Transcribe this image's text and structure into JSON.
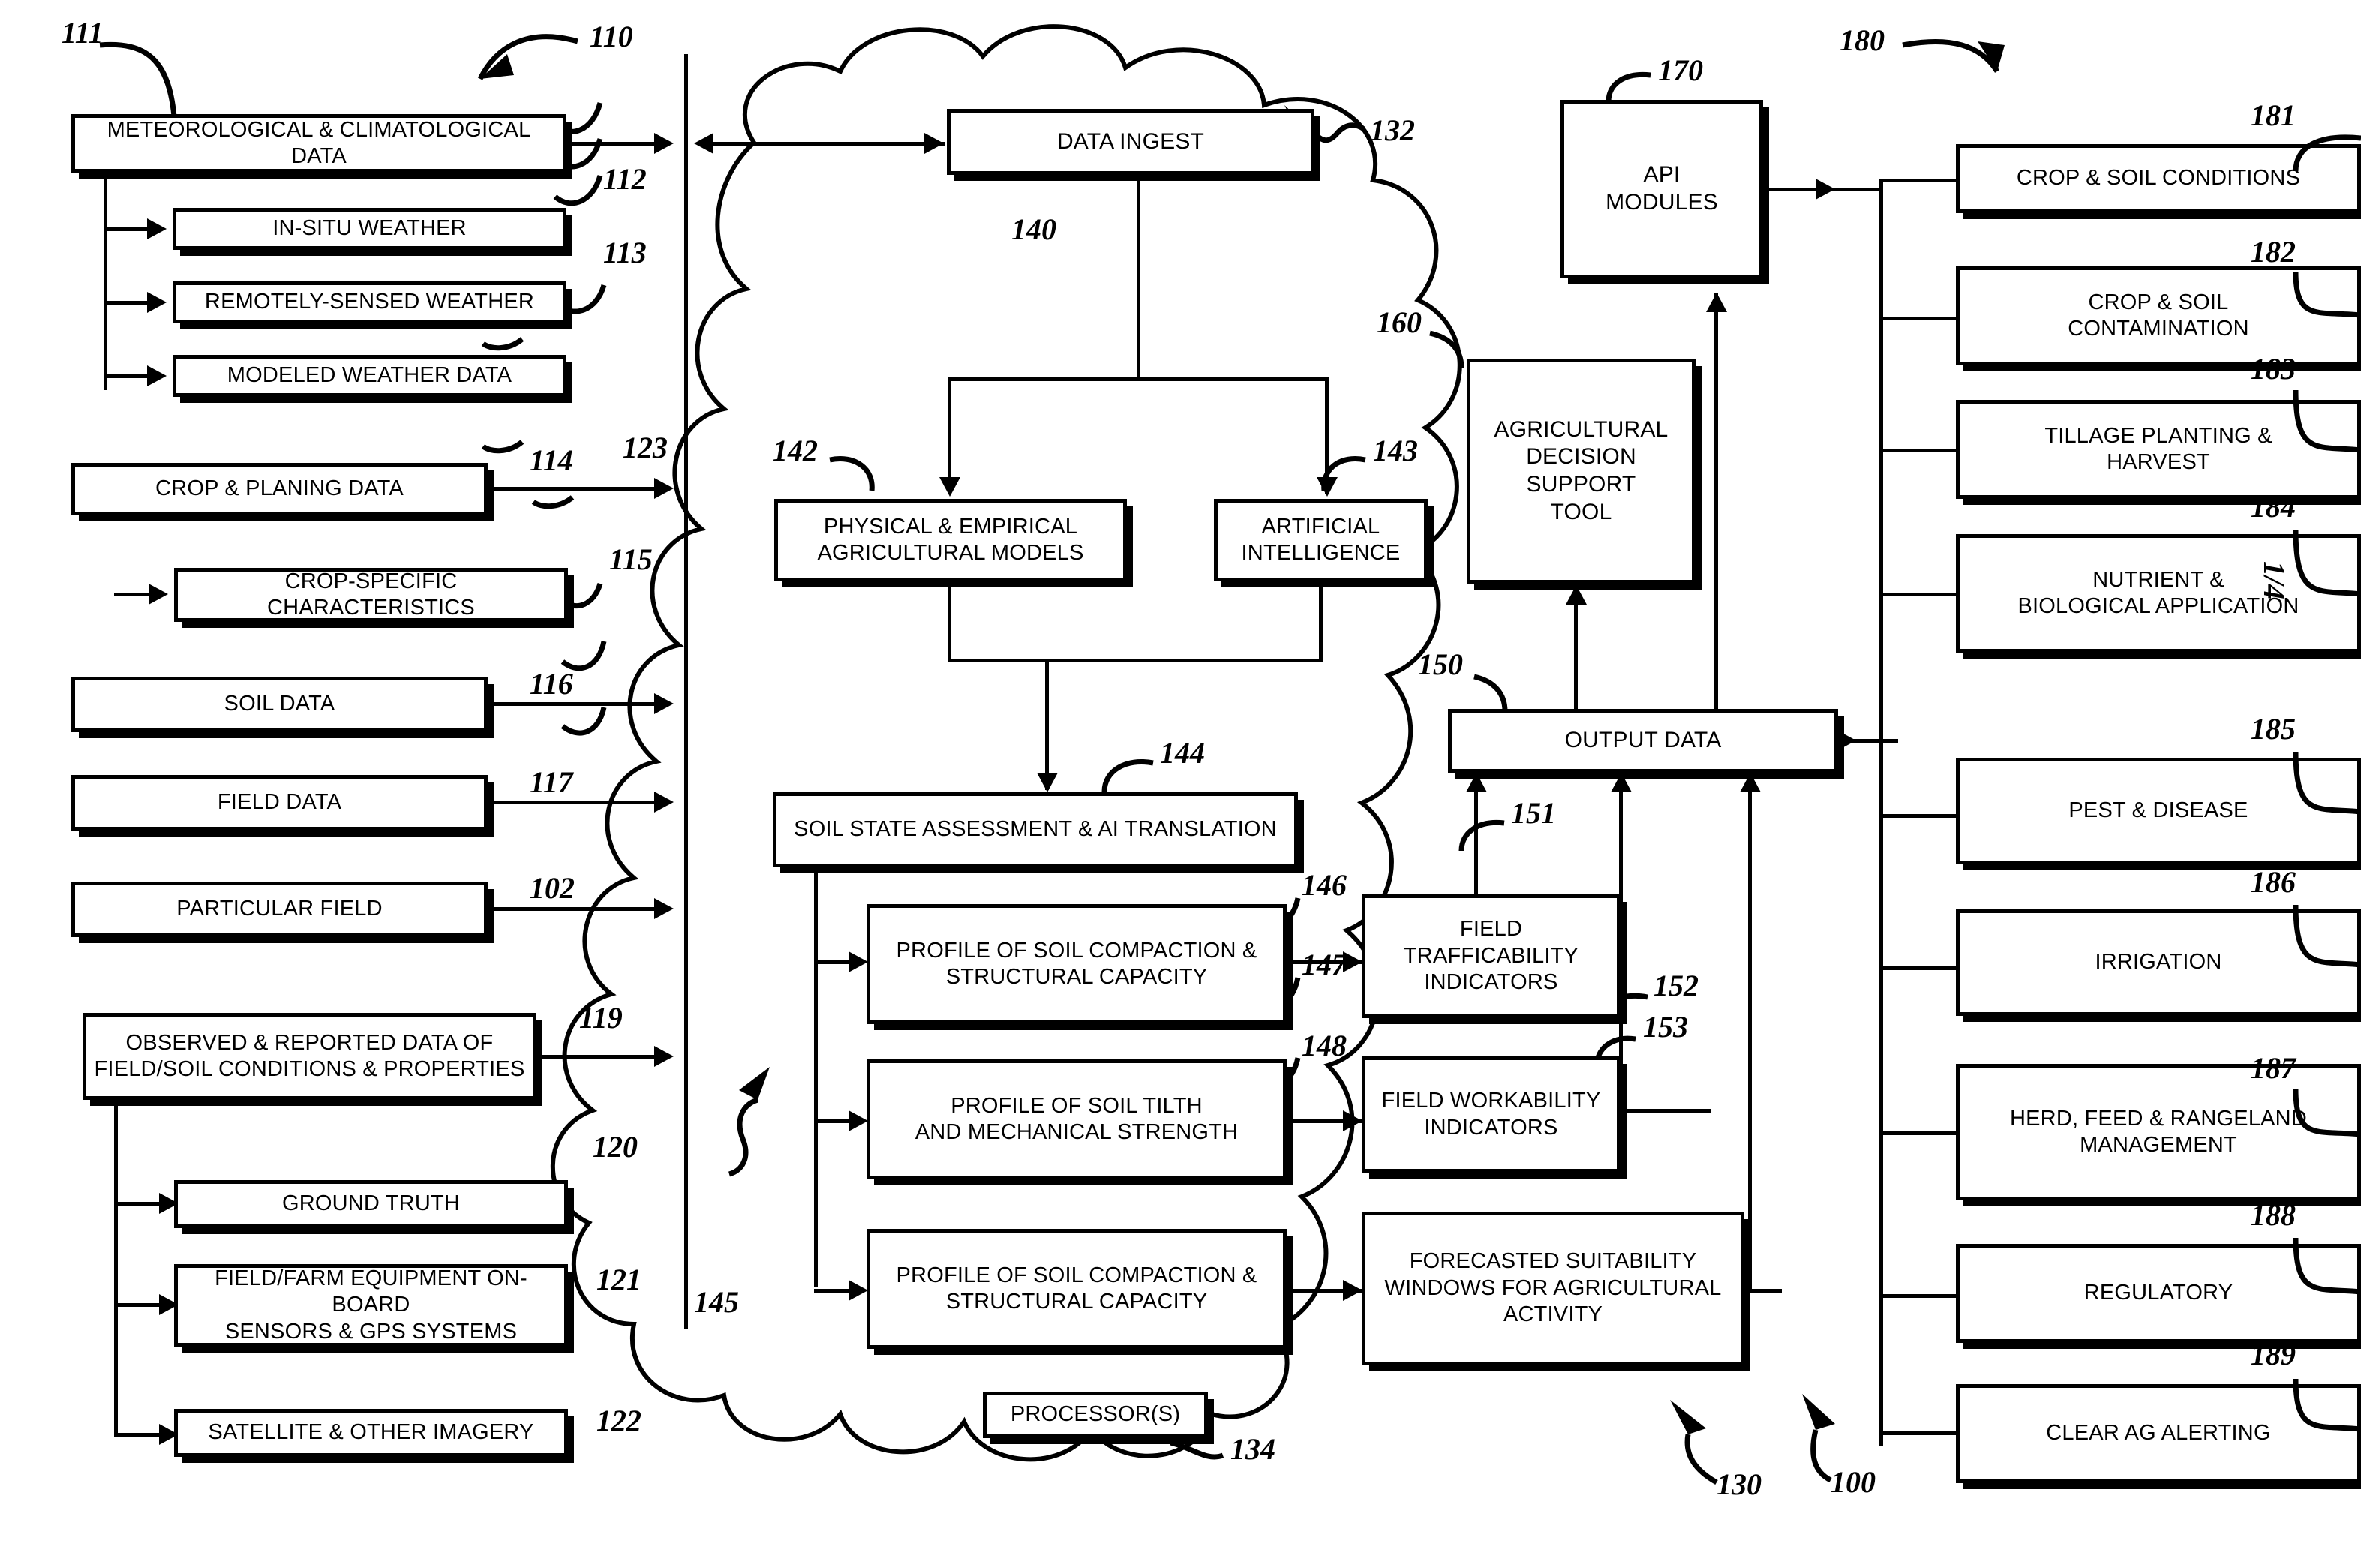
{
  "figure": {
    "page_label": "1/4",
    "system_ref": "100",
    "input_bus_ref": "110",
    "cloud_ref": "132",
    "cloud_ref2": "130",
    "output_group_ref": "180"
  },
  "inputs": {
    "items": [
      {
        "label": "METEOROLOGICAL & CLIMATOLOGICAL DATA",
        "ref": "111"
      },
      {
        "label": "IN-SITU WEATHER",
        "ref": "112"
      },
      {
        "label": "REMOTELY-SENSED WEATHER",
        "ref": "113"
      },
      {
        "label": "MODELED WEATHER DATA",
        "ref": "123"
      },
      {
        "label": "CROP & PLANING DATA",
        "ref": "114"
      },
      {
        "label": "CROP-SPECIFIC CHARACTERISTICS",
        "ref": "115"
      },
      {
        "label": "SOIL DATA",
        "ref": "116"
      },
      {
        "label": "FIELD DATA",
        "ref": "117"
      },
      {
        "label": "PARTICULAR FIELD",
        "ref": "102"
      },
      {
        "label": "OBSERVED & REPORTED DATA OF FIELD/SOIL CONDITIONS & PROPERTIES",
        "ref": "119"
      },
      {
        "label": "GROUND TRUTH",
        "ref": "120"
      },
      {
        "label": "FIELD/FARM EQUIPMENT ON-BOARD SENSORS & GPS SYSTEMS",
        "ref": "121"
      },
      {
        "label": "SATELLITE & OTHER IMAGERY",
        "ref": "122"
      }
    ],
    "observed_line1": "OBSERVED & REPORTED DATA OF",
    "observed_line2": "FIELD/SOIL CONDITIONS & PROPERTIES",
    "equipment_line1": "FIELD/FARM EQUIPMENT ON-BOARD",
    "equipment_line2": "SENSORS & GPS SYSTEMS"
  },
  "processing": {
    "data_ingest": {
      "label": "DATA INGEST",
      "ref": "140"
    },
    "models": {
      "line1": "PHYSICAL & EMPIRICAL",
      "line2": "AGRICULTURAL MODELS",
      "ref": "142"
    },
    "ai": {
      "line1": "ARTIFICIAL",
      "line2": "INTELLIGENCE",
      "ref": "143"
    },
    "soil_state": {
      "label": "SOIL STATE ASSESSMENT & AI TRANSLATION",
      "ref": "144"
    },
    "bus_ref": "145",
    "processors": {
      "label": "PROCESSOR(S)",
      "ref": "134"
    },
    "profiles": [
      {
        "line1": "PROFILE OF SOIL COMPACTION &",
        "line2": "STRUCTURAL CAPACITY",
        "ref": "146"
      },
      {
        "line1": "PROFILE OF SOIL TILTH",
        "line2": "AND MECHANICAL STRENGTH",
        "ref": "147"
      },
      {
        "line1": "PROFILE OF SOIL COMPACTION &",
        "line2": "STRUCTURAL CAPACITY",
        "ref": "148"
      }
    ],
    "indicators": [
      {
        "line1": "FIELD TRAFFICABILITY",
        "line2": "INDICATORS",
        "line3": "",
        "ref": "151"
      },
      {
        "line1": "FIELD WORKABILITY",
        "line2": "INDICATORS",
        "line3": "",
        "ref": "152"
      },
      {
        "line1": "FORECASTED SUITABILITY",
        "line2": "WINDOWS FOR AGRICULTURAL",
        "line3": "ACTIVITY",
        "ref": "153"
      }
    ],
    "decision_tool": {
      "line1": "AGRICULTURAL",
      "line2": "DECISION SUPPORT",
      "line3": "TOOL",
      "ref": "160"
    },
    "output_data": {
      "label": "OUTPUT DATA",
      "ref": "150"
    },
    "api_modules": {
      "line1": "API",
      "line2": "MODULES",
      "ref": "170"
    }
  },
  "outputs": {
    "items": [
      {
        "line1": "CROP & SOIL CONDITIONS",
        "line2": "",
        "ref": "181"
      },
      {
        "line1": "CROP & SOIL",
        "line2": "CONTAMINATION",
        "ref": "182"
      },
      {
        "line1": "TILLAGE PLANTING &",
        "line2": "HARVEST",
        "ref": "183"
      },
      {
        "line1": "NUTRIENT &",
        "line2": "BIOLOGICAL APPLICATION",
        "ref": "184"
      },
      {
        "line1": "PEST & DISEASE",
        "line2": "",
        "ref": "185"
      },
      {
        "line1": "IRRIGATION",
        "line2": "",
        "ref": "186"
      },
      {
        "line1": "HERD, FEED & RANGELAND",
        "line2": "MANAGEMENT",
        "ref": "187"
      },
      {
        "line1": "REGULATORY",
        "line2": "",
        "ref": "188"
      },
      {
        "line1": "CLEAR AG ALERTING",
        "line2": "",
        "ref": "189"
      }
    ]
  }
}
